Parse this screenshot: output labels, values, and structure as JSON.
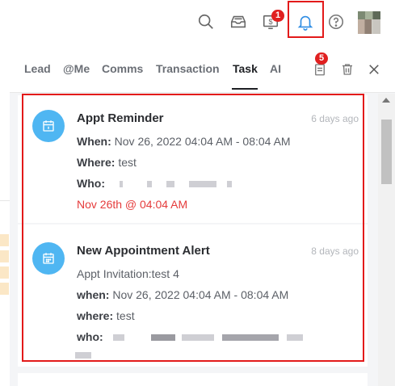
{
  "toolbar": {
    "icons": [
      "search-icon",
      "inbox-icon",
      "dollar-icon",
      "bell-icon",
      "help-icon"
    ],
    "dollar_badge": "1",
    "avatar_name": "avatar"
  },
  "panel": {
    "tabs": [
      {
        "label": "Lead",
        "active": false
      },
      {
        "label": "@Me",
        "active": false
      },
      {
        "label": "Comms",
        "active": false
      },
      {
        "label": "Transaction",
        "active": false
      },
      {
        "label": "Task",
        "active": true
      },
      {
        "label": "AI",
        "active": false
      }
    ],
    "task_badge": "5",
    "icons": [
      "task-list-icon",
      "trash-icon",
      "close-icon"
    ]
  },
  "cards": [
    {
      "title": "Appt Reminder",
      "time": "6 days ago",
      "when_label": "When:",
      "when_value": "Nov 26, 2022 04:04 AM - 08:04 AM",
      "where_label": "Where:",
      "where_value": "test",
      "who_label": "Who:",
      "reminder": "Nov 26th @ 04:04 AM"
    },
    {
      "title": "New Appointment Alert",
      "time": "8 days ago",
      "subtitle": "Appt Invitation:test 4",
      "when_label": "when:",
      "when_value": "Nov 26, 2022 04:04 AM - 08:04 AM",
      "where_label": "where:",
      "where_value": "test",
      "who_label": "who:"
    }
  ],
  "colors": {
    "accent_blue": "#4fb6f2",
    "badge_red": "#e02020",
    "highlight_red": "#e31a1a",
    "reminder_red": "#e53b3b"
  }
}
